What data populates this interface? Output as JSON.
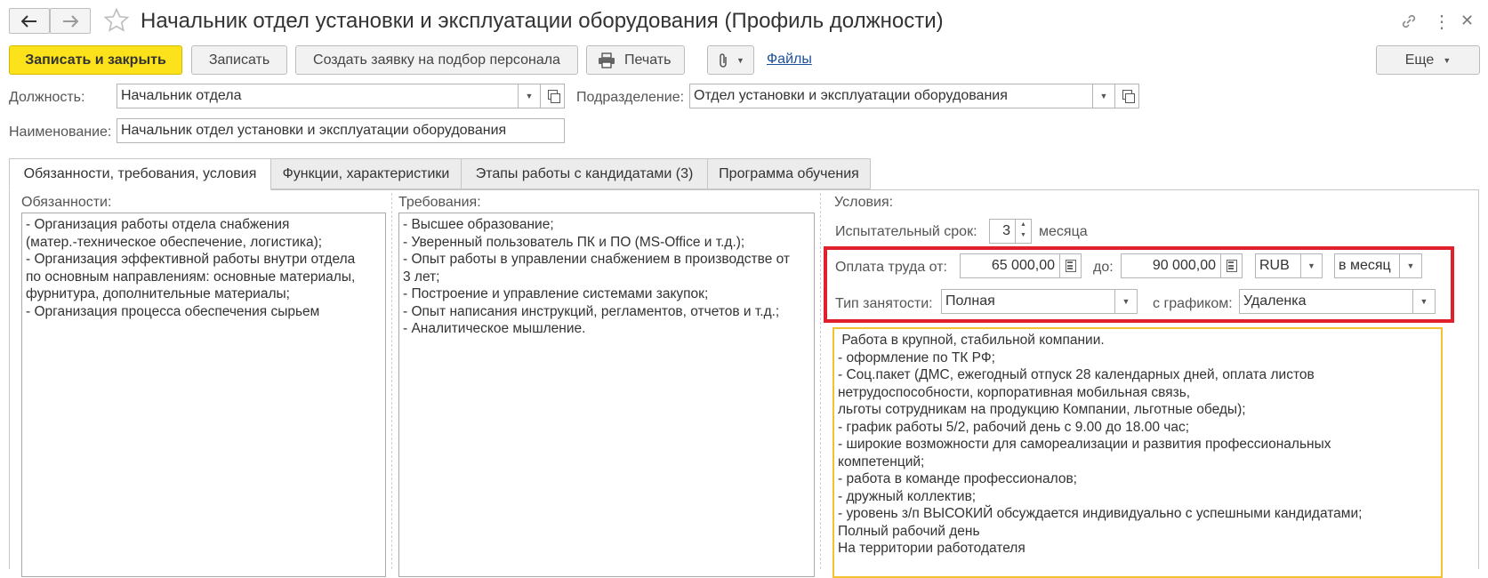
{
  "window": {
    "title": "Начальник отдел установки и эксплуатации оборудования (Профиль должности)"
  },
  "toolbar": {
    "save_close": "Записать и закрыть",
    "save": "Записать",
    "create_request": "Создать заявку на подбор персонала",
    "print": "Печать",
    "files": "Файлы",
    "more": "Еще"
  },
  "form": {
    "position_label": "Должность:",
    "position_value": "Начальник отдела",
    "department_label": "Подразделение:",
    "department_value": "Отдел установки и эксплуатации оборудования",
    "name_label": "Наименование:",
    "name_value": "Начальник отдел установки и эксплуатации оборудования"
  },
  "tabs": [
    {
      "label": "Обязанности, требования, условия",
      "active": true
    },
    {
      "label": "Функции, характеристики",
      "active": false
    },
    {
      "label": "Этапы работы с кандидатами (3)",
      "active": false
    },
    {
      "label": "Программа обучения",
      "active": false
    }
  ],
  "duties": {
    "label": "Обязанности:",
    "text": "- Организация работы отдела снабжения\n(матер.-техническое обеспечение, логистика);\n- Организация эффективной работы внутри отдела\nпо основным направлениям: основные материалы,\nфурнитура, дополнительные материалы;\n- Организация процесса обеспечения сырьем"
  },
  "requirements": {
    "label": "Требования:",
    "text": "- Высшее образование;\n- Уверенный пользователь ПК и ПО (MS-Office и т.д.);\n- Опыт работы в управлении снабжением в производстве от\n3 лет;\n- Построение и управление системами закупок;\n- Опыт написания инструкций, регламентов, отчетов и т.д.;\n- Аналитическое мышление."
  },
  "conditions": {
    "label": "Условия:",
    "probation_label": "Испытательный срок:",
    "probation_value": "3",
    "probation_unit": "месяца",
    "salary_from_label": "Оплата труда от:",
    "salary_from": "65 000,00",
    "salary_to_label": "до:",
    "salary_to": "90 000,00",
    "currency": "RUB",
    "period": "в месяц",
    "employment_label": "Тип занятости:",
    "employment_value": "Полная",
    "schedule_label": "с графиком:",
    "schedule_value": "Удаленка",
    "text": " Работа в крупной, стабильной компании.\n- оформление по ТК РФ;\n- Соц.пакет (ДМС, ежегодный отпуск 28 календарных дней, оплата листов\nнетрудоспособности, корпоративная мобильная связь,\nльготы сотрудникам на продукцию Компании, льготные обеды);\n- график работы 5/2, рабочий день с 9.00 до 18.00 час;\n- широкие возможности для самореализации и развития профессиональных\nкомпетенций;\n- работа в команде профессионалов;\n- дружный коллектив;\n- уровень з/п ВЫСОКИЙ обсуждается индивидуально с успешными кандидатами;\nПолный рабочий день\nНа территории работодателя"
  },
  "colors": {
    "primary_button": "#fbe21a",
    "highlight_frame": "#e0202a",
    "active_textarea_border": "#f2c230",
    "link": "#1b4f9e"
  }
}
